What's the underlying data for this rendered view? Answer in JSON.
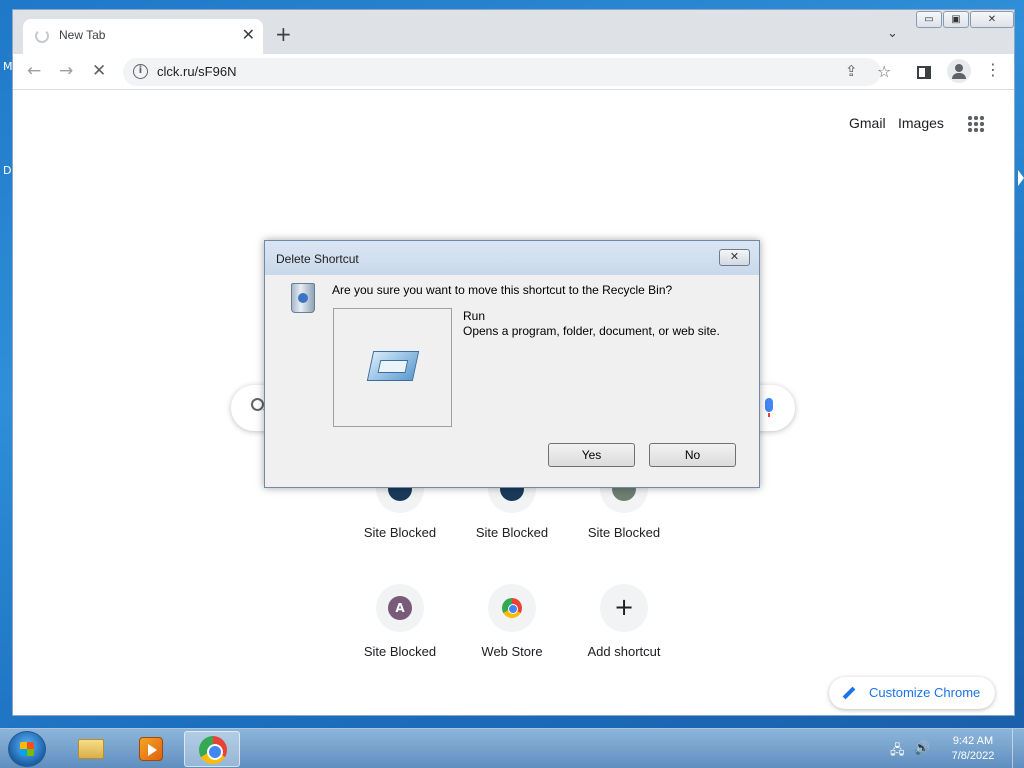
{
  "desktop": {
    "left_text_1": "M",
    "left_text_2": "D"
  },
  "browser": {
    "tab": {
      "title": "New Tab",
      "close": "✕"
    },
    "new_tab": "+",
    "tab_list": "⌄",
    "window_controls": {
      "minimize": "▭",
      "maximize": "▣",
      "close": "✕"
    },
    "toolbar": {
      "back": "←",
      "forward": "→",
      "reload": "✕",
      "info": "i",
      "url": "clck.ru/sF96N",
      "share": "⇪",
      "star": "☆",
      "menu": "⋮"
    }
  },
  "ntp": {
    "gmail": "Gmail",
    "images": "Images",
    "shortcuts": [
      {
        "label": "Site Blocked",
        "letter": "",
        "color": "#1a3a5c"
      },
      {
        "label": "Site Blocked",
        "letter": "",
        "color": "#1a3a5c"
      },
      {
        "label": "Site Blocked",
        "letter": "",
        "color": "#6f7f72"
      },
      {
        "label": "Site Blocked",
        "letter": "A",
        "color": "#7a5a7a"
      },
      {
        "label": "Web Store",
        "letter": "",
        "color": ""
      },
      {
        "label": "Add shortcut",
        "letter": "+",
        "color": ""
      }
    ],
    "customize": "Customize Chrome"
  },
  "dialog": {
    "title": "Delete Shortcut",
    "close": "✕",
    "question": "Are you sure you want to move this shortcut to the Recycle Bin?",
    "item_name": "Run",
    "item_description": "Opens a program, folder, document, or web site.",
    "yes": "Yes",
    "no": "No"
  },
  "taskbar": {
    "network": "🖧",
    "volume": "🔊",
    "time": "9:42 AM",
    "date": "7/8/2022"
  }
}
